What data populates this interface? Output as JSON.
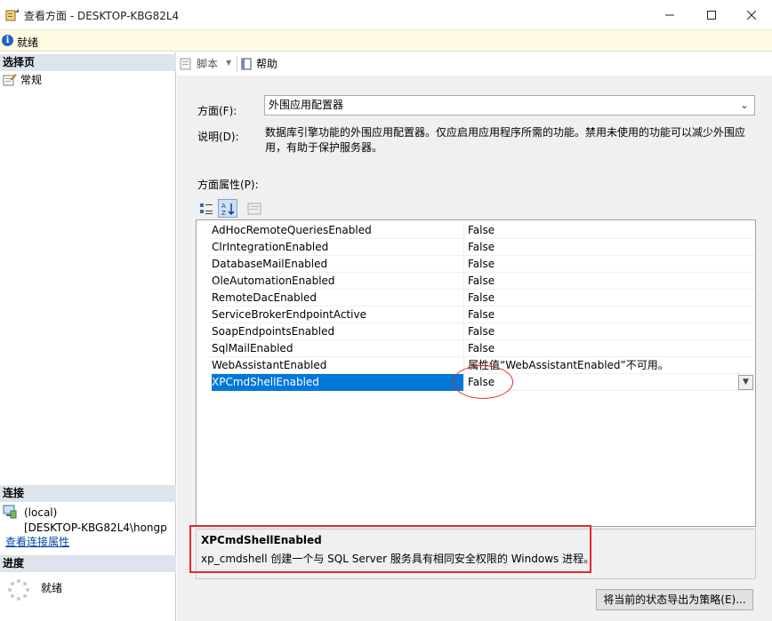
{
  "window": {
    "title": "查看方面 - DESKTOP-KBG82L4"
  },
  "status": {
    "text": "就绪"
  },
  "left": {
    "select_page_header": "选择页",
    "pages": [
      {
        "label": "常规",
        "icon": "page-wrench-icon"
      }
    ],
    "connection_header": "连接",
    "server": "(local)",
    "login": "[DESKTOP-KBG82L4\\hongp",
    "view_connection_link": "查看连接属性",
    "progress_header": "进度",
    "progress_status": "就绪"
  },
  "toolbar": {
    "script_label": "脚本",
    "help_label": "帮助"
  },
  "form": {
    "facet_label": "方面(F):",
    "facet_value": "外围应用配置器",
    "description_label": "说明(D):",
    "description": "数据库引擎功能的外围应用配置器。仅应启用应用程序所需的功能。禁用未使用的功能可以减少外围应用，有助于保护服务器。",
    "properties_label": "方面属性(P):"
  },
  "properties": [
    {
      "name": "AdHocRemoteQueriesEnabled",
      "value": "False"
    },
    {
      "name": "ClrIntegrationEnabled",
      "value": "False"
    },
    {
      "name": "DatabaseMailEnabled",
      "value": "False"
    },
    {
      "name": "OleAutomationEnabled",
      "value": "False"
    },
    {
      "name": "RemoteDacEnabled",
      "value": "False"
    },
    {
      "name": "ServiceBrokerEndpointActive",
      "value": "False"
    },
    {
      "name": "SoapEndpointsEnabled",
      "value": "False"
    },
    {
      "name": "SqlMailEnabled",
      "value": "False"
    },
    {
      "name": "WebAssistantEnabled",
      "value": "属性值“WebAssistantEnabled”不可用。"
    },
    {
      "name": "XPCmdShellEnabled",
      "value": "False",
      "selected": true
    }
  ],
  "help": {
    "title": "XPCmdShellEnabled",
    "description": "xp_cmdshell 创建一个与 SQL Server 服务具有相同安全权限的 Windows 进程。"
  },
  "export_button": "将当前的状态导出为策略(E)...",
  "colors": {
    "selection": "#0078d7",
    "annotation": "#e8272a",
    "status_bg": "#fffbe3"
  }
}
